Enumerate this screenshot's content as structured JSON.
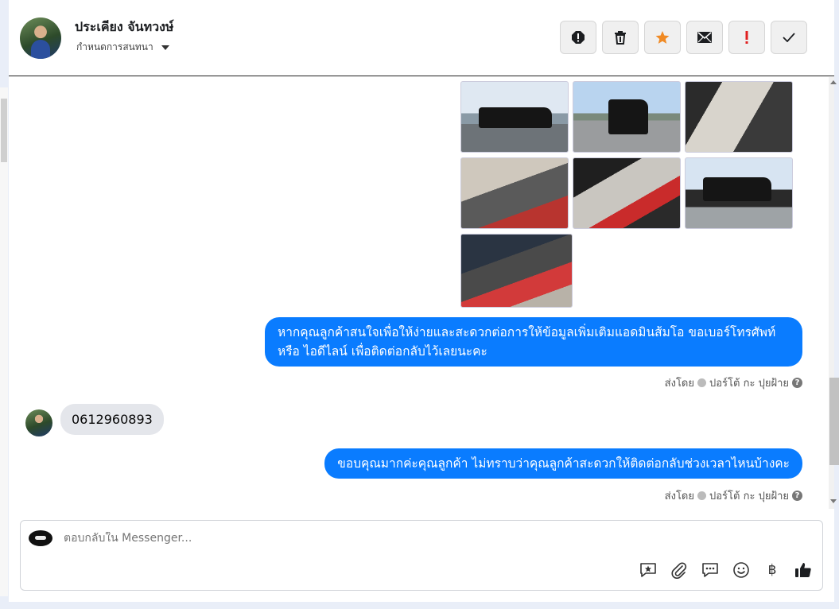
{
  "header": {
    "contact_name": "ประเคียง จันทวงษ์",
    "settings_label": "กำหนดการสนทนา",
    "toolbar_icons": [
      "alert-circle-icon",
      "trash-icon",
      "star-icon",
      "envelope-icon",
      "exclamation-icon",
      "check-icon"
    ],
    "star_color": "#f08a24",
    "exclamation_color": "#e02020"
  },
  "messages": [
    {
      "type": "image-grid",
      "from": "page",
      "image_count": 7
    },
    {
      "type": "text",
      "from": "page",
      "text": "หากคุณลูกค้าสนใจเพื่อให้ง่ายและสะดวกต่อการให้ข้อมูลเพิ่มเติมแอดมินส้มโอ ขอเบอร์โทรศัพท์ หรือ ไอดีไลน์ เพื่อติดต่อกลับไว้เลยนะคะ",
      "sent_by_prefix": "ส่งโดย",
      "sent_by_name": "ปอร์โต้ กะ ปุยฝ้าย"
    },
    {
      "type": "text",
      "from": "customer",
      "text": "0612960893"
    },
    {
      "type": "text",
      "from": "page",
      "text": "ขอบคุณมากค่ะคุณลูกค้า ไม่ทราบว่าคุณลูกค้าสะดวกให้ติดต่อกลับช่วงเวลาไหนบ้างคะ",
      "sent_by_prefix": "ส่งโดย",
      "sent_by_name": "ปอร์โต้ กะ ปุยฝ้าย"
    }
  ],
  "composer": {
    "placeholder": "ตอบกลับใน Messenger...",
    "tools": [
      "saved-reply-icon",
      "attachment-icon",
      "chat-bubble-icon",
      "emoji-icon",
      "baht-icon",
      "thumbs-up-icon"
    ],
    "baht_symbol": "฿"
  },
  "colors": {
    "bubble_out": "#0a7cff",
    "bubble_in": "#e4e6eb"
  }
}
